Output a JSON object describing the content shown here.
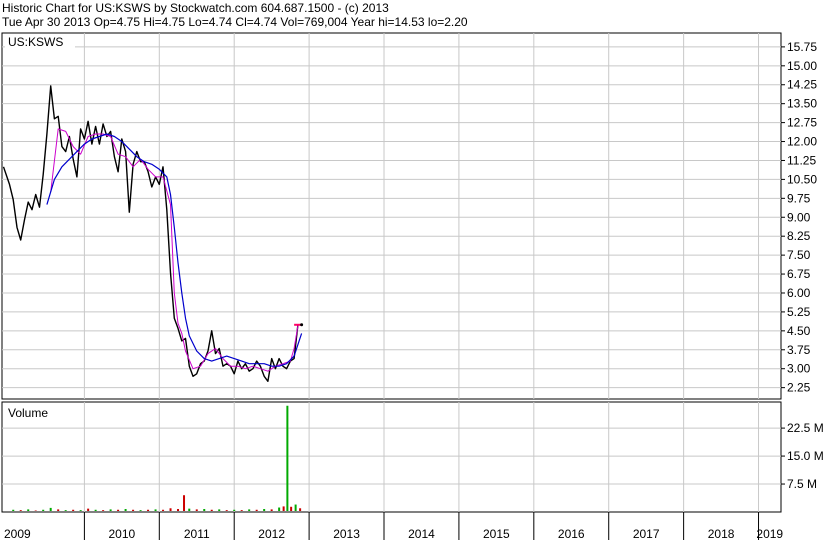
{
  "header": {
    "line1": "Historic Chart for US:KSWS by Stockwatch.com 604.687.1500 - (c) 2013",
    "line2": "Tue Apr 30 2013  Op=4.75  Hi=4.75  Lo=4.74  Cl=4.74  Vol=769,004  Year hi=14.53  lo=2.20"
  },
  "colors": {
    "price": "#000000",
    "ma_short": "#cc00cc",
    "ma_long": "#0000cc",
    "volume_up": "#00aa00",
    "volume_down": "#cc0000",
    "grid": "#c8c8c8",
    "last_mark": "#ff0066"
  },
  "chart_data": [
    {
      "type": "line",
      "panel_label": "US:KSWS",
      "x_tick_labels": [
        "2009",
        "2010",
        "2011",
        "2012",
        "2013",
        "2014",
        "2015",
        "2016",
        "2017",
        "2018",
        "2019"
      ],
      "y_tick_labels": [
        "15.75",
        "15.00",
        "14.25",
        "13.50",
        "12.75",
        "12.00",
        "11.25",
        "10.50",
        "9.75",
        "9.00",
        "8.25",
        "7.50",
        "6.75",
        "6.00",
        "5.25",
        "4.50",
        "3.75",
        "3.00",
        "2.25"
      ],
      "ylim": [
        1.8,
        16.3
      ],
      "xlim": [
        2008.9,
        2019.3
      ],
      "y_axis_side": "right",
      "grid": true,
      "series": [
        {
          "key": "price",
          "x": [
            2008.92,
            2009.0,
            2009.05,
            2009.1,
            2009.15,
            2009.2,
            2009.25,
            2009.3,
            2009.35,
            2009.4,
            2009.45,
            2009.5,
            2009.55,
            2009.6,
            2009.65,
            2009.7,
            2009.75,
            2009.8,
            2009.85,
            2009.9,
            2009.95,
            2010.0,
            2010.05,
            2010.1,
            2010.15,
            2010.2,
            2010.25,
            2010.3,
            2010.35,
            2010.4,
            2010.45,
            2010.5,
            2010.55,
            2010.6,
            2010.65,
            2010.7,
            2010.75,
            2010.8,
            2010.85,
            2010.9,
            2010.95,
            2011.0,
            2011.05,
            2011.1,
            2011.15,
            2011.2,
            2011.25,
            2011.3,
            2011.35,
            2011.4,
            2011.45,
            2011.5,
            2011.55,
            2011.6,
            2011.65,
            2011.7,
            2011.75,
            2011.8,
            2011.85,
            2011.9,
            2011.95,
            2012.0,
            2012.05,
            2012.1,
            2012.15,
            2012.2,
            2012.25,
            2012.3,
            2012.35,
            2012.4,
            2012.45,
            2012.5,
            2012.55,
            2012.6,
            2012.65,
            2012.7,
            2012.75,
            2012.8,
            2012.85,
            2012.9
          ],
          "y": [
            11.0,
            10.3,
            9.7,
            8.6,
            8.1,
            8.9,
            9.6,
            9.3,
            9.9,
            9.4,
            10.7,
            12.3,
            14.2,
            12.9,
            13.0,
            11.8,
            11.6,
            12.2,
            11.3,
            10.6,
            12.5,
            12.1,
            12.8,
            11.9,
            12.6,
            11.9,
            12.7,
            12.2,
            12.4,
            11.4,
            10.8,
            12.1,
            11.6,
            9.2,
            11.1,
            11.6,
            11.2,
            11.2,
            10.8,
            10.2,
            10.6,
            10.3,
            11.0,
            9.3,
            6.8,
            5.0,
            4.6,
            4.1,
            4.2,
            3.1,
            2.7,
            2.8,
            3.2,
            3.3,
            3.7,
            4.5,
            3.6,
            3.8,
            3.1,
            3.2,
            3.1,
            2.8,
            3.3,
            3.0,
            3.2,
            2.9,
            3.0,
            3.3,
            3.1,
            2.7,
            2.5,
            3.4,
            3.0,
            3.4,
            3.1,
            3.0,
            3.3,
            3.4,
            4.74,
            4.74
          ]
        },
        {
          "key": "ma_short",
          "x": [
            2009.55,
            2009.65,
            2009.75,
            2009.85,
            2009.95,
            2010.05,
            2010.15,
            2010.25,
            2010.35,
            2010.45,
            2010.55,
            2010.65,
            2010.75,
            2010.85,
            2010.95,
            2011.05,
            2011.15,
            2011.2,
            2011.25,
            2011.3,
            2011.35,
            2011.45,
            2011.55,
            2011.65,
            2011.75,
            2011.85,
            2011.95,
            2012.05,
            2012.15,
            2012.25,
            2012.35,
            2012.45,
            2012.55,
            2012.65,
            2012.75,
            2012.8,
            2012.85
          ],
          "y": [
            10.0,
            12.5,
            12.4,
            11.8,
            11.5,
            12.2,
            12.3,
            12.3,
            12.2,
            11.5,
            11.4,
            11.0,
            11.3,
            10.9,
            10.6,
            10.6,
            9.5,
            6.0,
            4.8,
            4.4,
            3.7,
            3.0,
            3.1,
            3.6,
            3.8,
            3.4,
            3.1,
            3.1,
            3.0,
            3.1,
            3.0,
            2.9,
            3.1,
            3.2,
            3.3,
            3.8,
            4.7
          ]
        },
        {
          "key": "ma_long",
          "x": [
            2009.5,
            2009.6,
            2009.7,
            2009.8,
            2009.9,
            2010.0,
            2010.1,
            2010.2,
            2010.3,
            2010.4,
            2010.5,
            2010.6,
            2010.7,
            2010.8,
            2010.9,
            2011.0,
            2011.1,
            2011.15,
            2011.2,
            2011.25,
            2011.3,
            2011.35,
            2011.4,
            2011.5,
            2011.6,
            2011.7,
            2011.8,
            2011.9,
            2012.0,
            2012.1,
            2012.2,
            2012.3,
            2012.4,
            2012.5,
            2012.6,
            2012.7,
            2012.8,
            2012.9
          ],
          "y": [
            9.5,
            10.5,
            11.0,
            11.3,
            11.6,
            11.9,
            12.1,
            12.2,
            12.3,
            12.2,
            12.0,
            11.7,
            11.4,
            11.2,
            11.1,
            10.9,
            10.6,
            9.9,
            8.6,
            7.2,
            6.0,
            5.0,
            4.3,
            3.7,
            3.4,
            3.3,
            3.4,
            3.5,
            3.4,
            3.3,
            3.2,
            3.2,
            3.2,
            3.1,
            3.1,
            3.2,
            3.5,
            4.4
          ]
        }
      ],
      "last_marker": {
        "x": [
          2012.8,
          2012.9
        ],
        "y": 4.74
      }
    },
    {
      "type": "bar",
      "panel_label": "Volume",
      "y_tick_labels": [
        "22.5 M",
        "15.0 M",
        "7.5 M"
      ],
      "y_tick_values": [
        22.5,
        15.0,
        7.5
      ],
      "ylim": [
        0,
        29.5
      ],
      "unit": "M",
      "bars": [
        {
          "x": 2009.05,
          "v": 0.6,
          "up": true
        },
        {
          "x": 2009.15,
          "v": 0.5,
          "up": false
        },
        {
          "x": 2009.25,
          "v": 0.7,
          "up": true
        },
        {
          "x": 2009.35,
          "v": 0.4,
          "up": false
        },
        {
          "x": 2009.45,
          "v": 0.6,
          "up": true
        },
        {
          "x": 2009.55,
          "v": 1.1,
          "up": true
        },
        {
          "x": 2009.65,
          "v": 0.7,
          "up": false
        },
        {
          "x": 2009.75,
          "v": 0.5,
          "up": true
        },
        {
          "x": 2009.85,
          "v": 0.6,
          "up": false
        },
        {
          "x": 2009.95,
          "v": 0.5,
          "up": true
        },
        {
          "x": 2010.05,
          "v": 0.9,
          "up": false
        },
        {
          "x": 2010.15,
          "v": 0.6,
          "up": true
        },
        {
          "x": 2010.25,
          "v": 0.5,
          "up": false
        },
        {
          "x": 2010.35,
          "v": 0.7,
          "up": true
        },
        {
          "x": 2010.45,
          "v": 0.6,
          "up": false
        },
        {
          "x": 2010.55,
          "v": 0.8,
          "up": true
        },
        {
          "x": 2010.65,
          "v": 0.6,
          "up": false
        },
        {
          "x": 2010.75,
          "v": 0.5,
          "up": true
        },
        {
          "x": 2010.85,
          "v": 0.6,
          "up": false
        },
        {
          "x": 2010.95,
          "v": 0.7,
          "up": true
        },
        {
          "x": 2011.05,
          "v": 0.6,
          "up": false
        },
        {
          "x": 2011.15,
          "v": 1.0,
          "up": false
        },
        {
          "x": 2011.25,
          "v": 0.8,
          "up": false
        },
        {
          "x": 2011.33,
          "v": 4.5,
          "up": false
        },
        {
          "x": 2011.4,
          "v": 0.9,
          "up": true
        },
        {
          "x": 2011.5,
          "v": 0.7,
          "up": false
        },
        {
          "x": 2011.6,
          "v": 0.8,
          "up": true
        },
        {
          "x": 2011.7,
          "v": 0.6,
          "up": false
        },
        {
          "x": 2011.8,
          "v": 0.7,
          "up": true
        },
        {
          "x": 2011.9,
          "v": 0.5,
          "up": false
        },
        {
          "x": 2012.0,
          "v": 0.6,
          "up": true
        },
        {
          "x": 2012.1,
          "v": 0.5,
          "up": false
        },
        {
          "x": 2012.2,
          "v": 0.7,
          "up": true
        },
        {
          "x": 2012.3,
          "v": 0.6,
          "up": false
        },
        {
          "x": 2012.4,
          "v": 0.8,
          "up": true
        },
        {
          "x": 2012.5,
          "v": 0.7,
          "up": false
        },
        {
          "x": 2012.6,
          "v": 1.2,
          "up": true
        },
        {
          "x": 2012.66,
          "v": 1.5,
          "up": false
        },
        {
          "x": 2012.71,
          "v": 28.5,
          "up": true
        },
        {
          "x": 2012.76,
          "v": 1.4,
          "up": false
        },
        {
          "x": 2012.82,
          "v": 2.0,
          "up": true
        },
        {
          "x": 2012.88,
          "v": 1.0,
          "up": false
        }
      ]
    }
  ]
}
